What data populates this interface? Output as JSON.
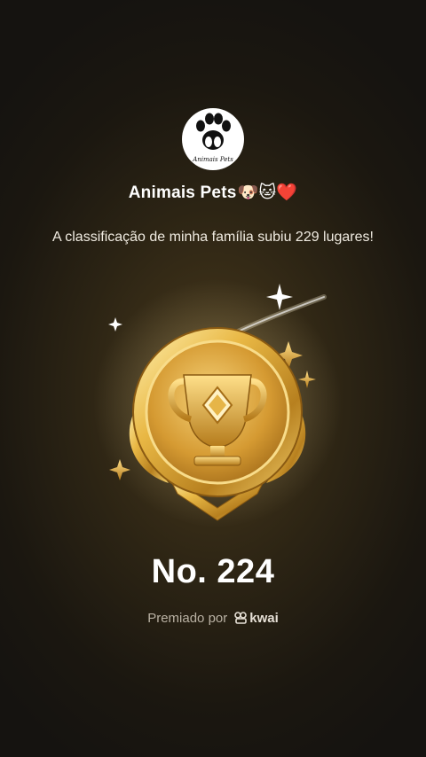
{
  "header": {
    "channel_name": "Animais Pets",
    "channel_emojis": "🐶🐱❤️",
    "avatar_text": "Animais Pets"
  },
  "message": "A classificação de minha família subiu 229 lugares!",
  "rank": "No. 224",
  "awarded": {
    "label": "Premiado por",
    "brand": "kwai"
  },
  "icons": [
    "paw-logo-icon",
    "trophy-medal-icon",
    "sparkle-icon",
    "kwai-logo-icon"
  ],
  "colors": {
    "gold": "#d9a93a",
    "background": "#2c2414"
  }
}
